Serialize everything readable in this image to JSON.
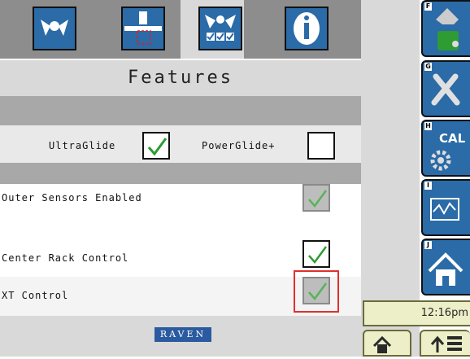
{
  "title": "Features",
  "tabs": [
    {
      "icon": "wing-boom-icon"
    },
    {
      "icon": "center-rack-icon"
    },
    {
      "icon": "wing-boom-checks-icon",
      "selected": true
    },
    {
      "icon": "info-icon"
    }
  ],
  "options": {
    "ultraglide_label": "UltraGlide",
    "ultraglide_checked": true,
    "powerglide_label": "PowerGlide+",
    "powerglide_checked": false
  },
  "settings": [
    {
      "label": "Outer Sensors Enabled",
      "checked": true,
      "disabled": true
    },
    {
      "label": "Center Rack Control",
      "checked": true,
      "disabled": false
    },
    {
      "label": "XT Control",
      "checked": true,
      "disabled": true,
      "highlighted": true
    }
  ],
  "logo_text": "RAVEN",
  "side_buttons": [
    {
      "letter": "F",
      "icon": "paint-bucket-icon"
    },
    {
      "letter": "G",
      "icon": "wrench-screwdriver-icon"
    },
    {
      "letter": "H",
      "icon": "calibration-gear-icon",
      "text": "CAL"
    },
    {
      "letter": "I",
      "icon": "chart-icon"
    },
    {
      "letter": "J",
      "icon": "home-icon"
    }
  ],
  "clock": "12:16pm",
  "bottom_buttons": [
    {
      "icon": "home-icon"
    },
    {
      "icon": "up-arrow-list-icon"
    }
  ],
  "colors": {
    "accent_blue": "#2a6ba8",
    "check_green": "#2e9b33",
    "highlight_red": "#e03030"
  }
}
